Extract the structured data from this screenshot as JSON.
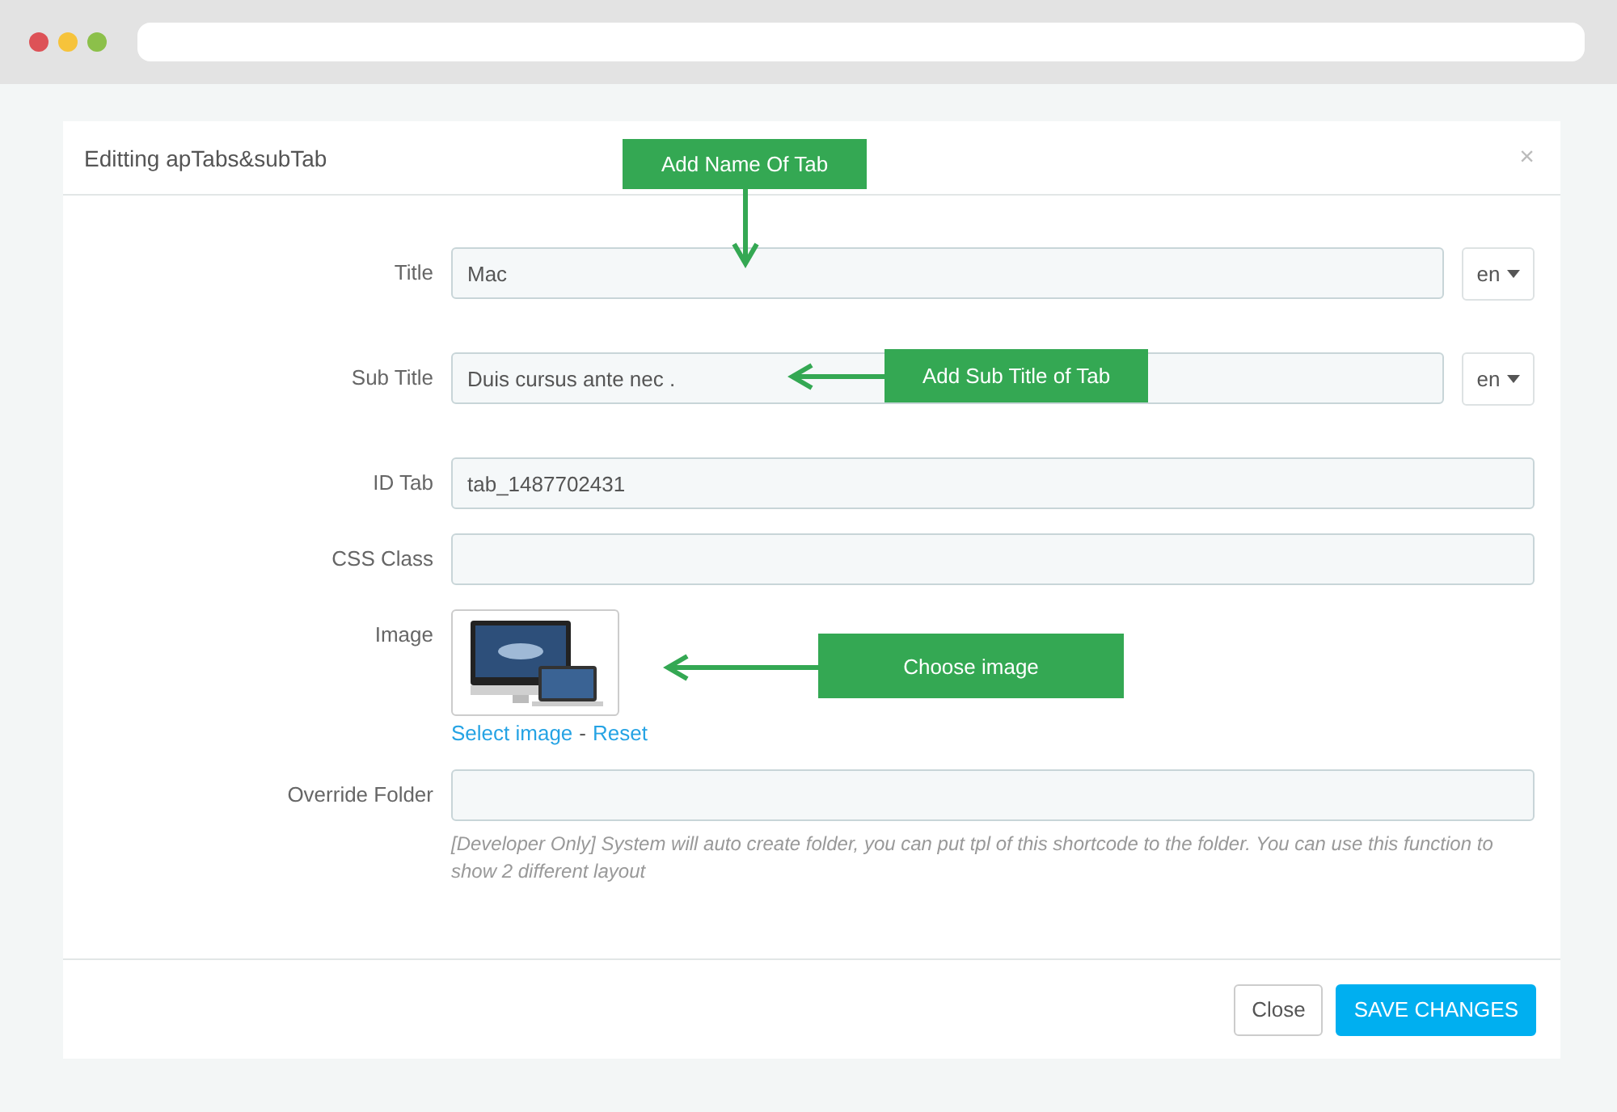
{
  "modal": {
    "title": "Editting apTabs&subTab",
    "close": "×"
  },
  "fields": [
    {
      "kind": "text",
      "label": "Title",
      "value": "Mac",
      "lang": "en"
    },
    {
      "kind": "text",
      "label": "Sub Title",
      "value": "Duis cursus ante nec .",
      "lang": "en"
    },
    {
      "kind": "text",
      "label": "ID Tab",
      "value": "tab_1487702431"
    },
    {
      "kind": "text",
      "label": "CSS Class"
    },
    {
      "kind": "image",
      "label": "Image",
      "select_link": "Select image",
      "separator": "-",
      "reset_link": "Reset"
    },
    {
      "kind": "text",
      "label": "Override Folder",
      "help": "[Developer Only] System will auto create folder, you can put tpl of this shortcode to the folder. You can use this function to show 2 different layout"
    }
  ],
  "buttons": [
    {
      "label": "Close",
      "kind": "default"
    },
    {
      "label": "SAVE CHANGES",
      "kind": "primary"
    }
  ],
  "annotations": [
    {
      "text": "Add Name Of Tab",
      "kind": "down"
    },
    {
      "text": "Add Sub Title of Tab",
      "kind": "left"
    },
    {
      "text": "Choose image",
      "kind": "left"
    }
  ]
}
